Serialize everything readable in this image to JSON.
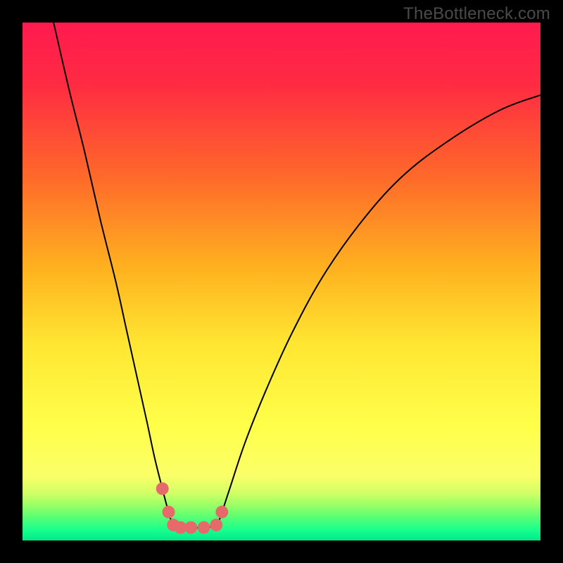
{
  "watermark": "TheBottleneck.com",
  "chart_data": {
    "type": "line",
    "title": "",
    "xlabel": "",
    "ylabel": "",
    "xlim": [
      0,
      100
    ],
    "ylim": [
      0,
      100
    ],
    "grid": false,
    "legend": false,
    "background_gradient_note": "vertical gradient from bright red (top) through orange and yellow to bright green (bottom ~10%)",
    "gradient_stops": [
      {
        "offset": 0.0,
        "color": "#ff1a4f"
      },
      {
        "offset": 0.12,
        "color": "#ff2b42"
      },
      {
        "offset": 0.3,
        "color": "#ff6a2a"
      },
      {
        "offset": 0.48,
        "color": "#ffb41f"
      },
      {
        "offset": 0.62,
        "color": "#ffe632"
      },
      {
        "offset": 0.78,
        "color": "#ffff4a"
      },
      {
        "offset": 0.875,
        "color": "#fbff68"
      },
      {
        "offset": 0.905,
        "color": "#d7ff66"
      },
      {
        "offset": 0.93,
        "color": "#9fff66"
      },
      {
        "offset": 0.955,
        "color": "#58ff74"
      },
      {
        "offset": 0.98,
        "color": "#17ff8e"
      },
      {
        "offset": 1.0,
        "color": "#00e98a"
      }
    ],
    "series": [
      {
        "name": "curve",
        "stroke": "#000000",
        "stroke_width": 2,
        "x": [
          6,
          9,
          12,
          15,
          18,
          20,
          22,
          24,
          25.5,
          27,
          28.2,
          29.1,
          30.5,
          32.5,
          35,
          37.4,
          38.5,
          40,
          43,
          47,
          52,
          58,
          65,
          73,
          82,
          92,
          100
        ],
        "y": [
          100,
          87,
          75,
          62,
          50,
          41,
          32,
          23,
          16,
          10,
          5.5,
          3.0,
          2.5,
          2.5,
          2.5,
          3.0,
          5.5,
          10,
          19,
          29,
          40,
          51,
          61,
          70,
          77,
          83,
          86
        ]
      }
    ],
    "markers": {
      "name": "dip-markers",
      "type": "scatter",
      "color": "#e66a6a",
      "radius": 9,
      "x": [
        27.0,
        28.2,
        29.1,
        30.5,
        32.5,
        35.0,
        37.4,
        38.5
      ],
      "y": [
        10.0,
        5.5,
        3.0,
        2.5,
        2.5,
        2.5,
        3.0,
        5.5
      ]
    }
  }
}
